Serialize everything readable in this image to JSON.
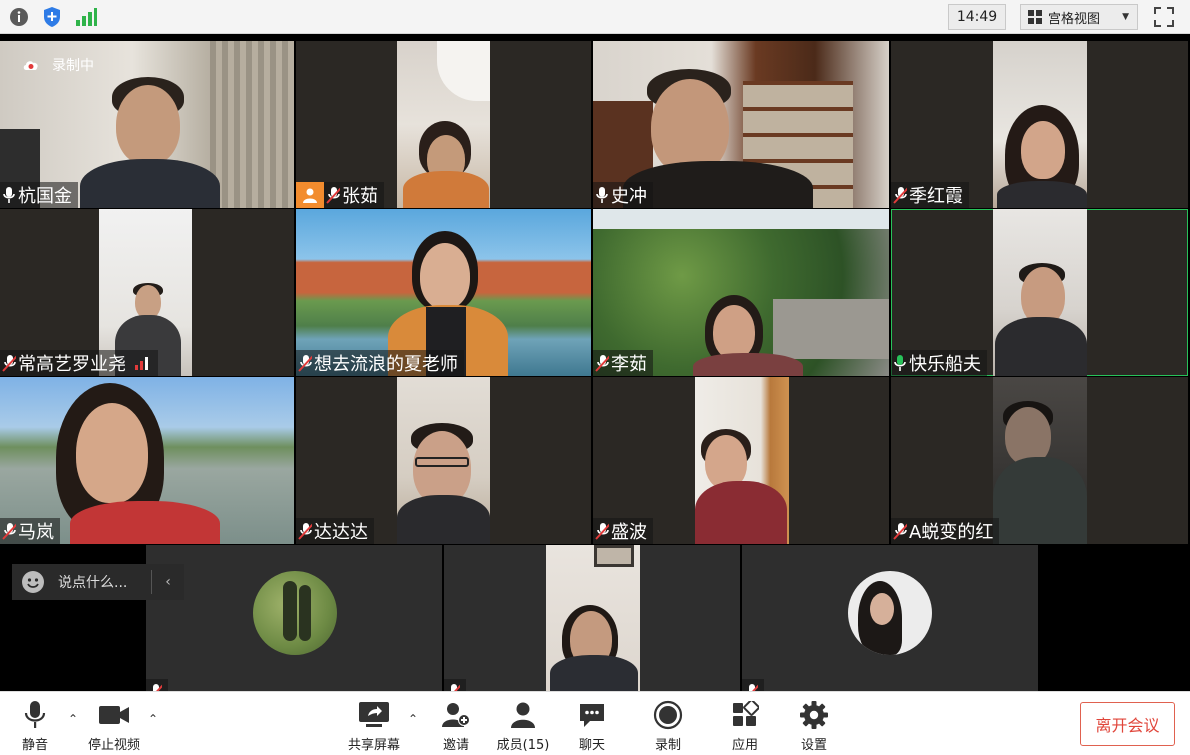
{
  "topbar": {
    "info_icon": "info-icon",
    "shield_icon": "shield-icon",
    "signal_icon": "signal-icon",
    "time": "14:49",
    "view_label": "宫格视图",
    "fullscreen_icon": "fullscreen-icon"
  },
  "recording": {
    "label": "录制中"
  },
  "participants": [
    {
      "name": "杭国金",
      "mic": "on"
    },
    {
      "name": "张茹",
      "mic": "muted"
    },
    {
      "name": "史冲",
      "mic": "on"
    },
    {
      "name": "季红霞",
      "mic": "muted"
    },
    {
      "name": "常高艺罗业尧",
      "mic": "muted"
    },
    {
      "name": "想去流浪的夏老师",
      "mic": "muted"
    },
    {
      "name": "李茹",
      "mic": "muted"
    },
    {
      "name": "快乐船夫",
      "mic": "speaking"
    },
    {
      "name": "马岚",
      "mic": "muted"
    },
    {
      "name": "达达达",
      "mic": "muted"
    },
    {
      "name": "盛波",
      "mic": "muted"
    },
    {
      "name": "A蜕变的红",
      "mic": "muted"
    }
  ],
  "chat": {
    "placeholder": "说点什么..."
  },
  "toolbar": {
    "mute": "静音",
    "stop_video": "停止视频",
    "share_screen": "共享屏幕",
    "invite": "邀请",
    "members": "成员(15)",
    "chat": "聊天",
    "record": "录制",
    "apps": "应用",
    "settings": "设置",
    "leave": "离开会议"
  },
  "colors": {
    "accent_green": "#28c25a",
    "leave_red": "#e0453a",
    "muted_red": "#e23b3b",
    "avatar_orange": "#f28c2e"
  }
}
